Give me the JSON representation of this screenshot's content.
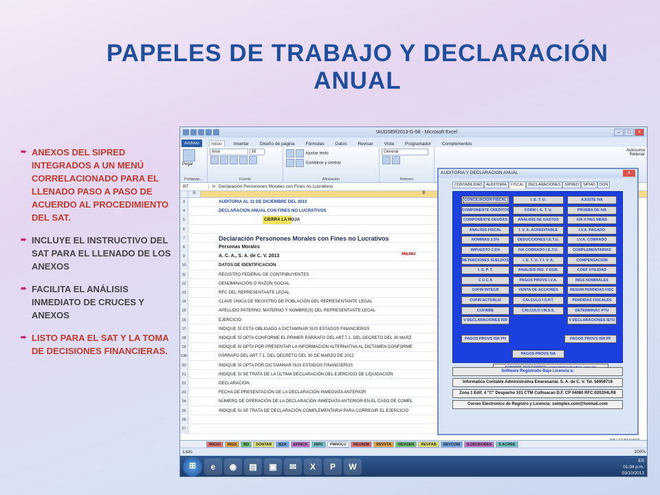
{
  "slide": {
    "title": "PAPELES DE TRABAJO Y DECLARACIÓN ANUAL",
    "bullets": [
      {
        "text": "ANEXOS DEL SIPRED INTEGRADOS A UN MENÚ CORRELACIONADO PARA EL LLENADO PASO A PASO DE ACUERDO AL PROCEDIMIENTO DEL SAT."
      },
      {
        "text": "INCLUYE EL INSTRUCTIVO DEL SAT PARA EL LLENADO DE LOS ANEXOS"
      },
      {
        "text": "FACILITA EL ANÁLISIS INMEDIATO DE CRUCES Y ANEXOS"
      },
      {
        "text": "LISTO PARA EL SAT Y LA TOMA DE DECISIONES FINANCIERAS."
      }
    ]
  },
  "excel": {
    "window_title": "!AUDSER2013-G-58 - Microsoft Excel",
    "tabs": [
      "Archivo",
      "Inicio",
      "Insertar",
      "Diseño de página",
      "Fórmulas",
      "Datos",
      "Revisar",
      "Vista",
      "Programador",
      "Complementos"
    ],
    "ribbon": {
      "paste": "Pegar",
      "font_name": "Arial",
      "font_size": "16",
      "wrap": "Ajustar texto",
      "merge": "Combinar y centrar",
      "number_format": "General",
      "autosum": "Autosuma",
      "fill": "Rellenar",
      "groups": [
        "Portapap...",
        "Fuente",
        "Alineación",
        "Número"
      ]
    },
    "name_box": "B7",
    "fx": "fx",
    "formula": "Declaración Personones Morales con Fines no Lucrativos",
    "columns": [
      "A",
      "B"
    ],
    "rows": [
      {
        "n": "3",
        "text": "AUDITORIA AL 31 DE DICIEMBRE DEL 2013"
      },
      {
        "n": "4",
        "text": "DECLARACION ANUAL CON FINES NO LUCRATIVOS"
      },
      {
        "n": "5",
        "text": "CIERRA LA HOJA"
      },
      {
        "n": "6",
        "text": ""
      },
      {
        "n": "7",
        "text": "Declaración Personones Morales con Fines no Lucrativos"
      },
      {
        "n": "8",
        "text": "Personas Morales"
      },
      {
        "n": "9",
        "text": "A. C. A., S. A. de C. V. 2013"
      },
      {
        "n": "10",
        "text": "DATOS DE IDENTIFICACION"
      },
      {
        "n": "11",
        "text": "REGISTRO FEDERAL DE CONTRIBUYENTES"
      },
      {
        "n": "12",
        "text": "DENOMINACIÓN O RAZON SOCIAL"
      },
      {
        "n": "13",
        "text": "RFC DEL REPRESENTANTE LEGAL"
      },
      {
        "n": "14",
        "text": "CLAVE ÚNICA DE REGISTRO DE POBLACIÓN DEL REPRESENTANTE LEGAL"
      },
      {
        "n": "15",
        "text": "APELLIDO PATERNO, MATERNO Y NOMBRE(S) DEL REPRESENTANTE LEGAL"
      },
      {
        "n": "16",
        "text": "EJERCICIO"
      },
      {
        "n": "17",
        "text": "INDIQUE SÍ ESTÁ OBLIGADO A DICTAMINAR SUS ESTADOS FINANCIEROS"
      },
      {
        "n": "18",
        "text": "INDIQUE SÍ OPTA CONFORME EL PRIMER PÁRRAFO DEL ART.7.1. DEL DECRETO DEL 30 MARZ"
      },
      {
        "n": "19",
        "text": "INDIQUE SI OPTA POR PRESENTAR LA INFORMACIÓN ALTERNATIVA AL DICTAMEN CONFORME"
      },
      {
        "n": "19b",
        "text": "PÁRRAFO DEL ART 7.1. DEL DECRETO DEL 30 DE MARZO DE 2012"
      },
      {
        "n": "20",
        "text": "INDIQUE SI OPTA POR DICTAMINAR SUS ESTADOS FINANCIEROS"
      },
      {
        "n": "21",
        "text": "INDIQUE SI SE TRATA DE LA ÚLTIMA DECLARACIÓN DEL EJERCICIO DE LIQUIDACIÓN"
      },
      {
        "n": "22",
        "text": "DECLARACIÓN"
      },
      {
        "n": "23",
        "text": "FECHA DE PRESENTACIÓN DE LA DECLARACIÓN INMEDIATA ANTERIOR"
      },
      {
        "n": "24",
        "text": "NÚMERO DE OPERACIÓN DE LA DECLARACIÓN INMEDIATA ANTERIOR EN EL CASO DE COMPL"
      },
      {
        "n": "25",
        "text": "INDIQUE SI SE TRATA DE DECLARACIÓN COMPLEMENTARIA PARA CORREGIR EL EJERCICIO"
      },
      {
        "n": "26",
        "text": ""
      },
      {
        "n": "27",
        "text": ""
      }
    ],
    "menu_label": "MENU",
    "sheet_tabs": [
      "INICIO",
      "INGS",
      "BD",
      "DONTAR",
      "BZA",
      "EFINCS",
      "INPC",
      "PMNOLU",
      "REVADM",
      "REVVTA",
      "REVGEN",
      "REVFAB",
      "REVCOM",
      "S.DEUDORES",
      "S.ACREE"
    ],
    "status_text": "Listo",
    "zoom": "100%",
    "tray_lang": "ES",
    "clock_time": "01:34 p.m.",
    "clock_date": "03/10/2013",
    "right_fragment": "PTU GENERADA"
  },
  "dialog": {
    "title": "AUDITORIA Y DECLARACION ANUAL",
    "close": "x",
    "tabs": [
      "CONTABILIDAD",
      "AUDITORIA",
      "FISCAL",
      "DECLARACIONES",
      "SIPRED",
      "SIPIAD",
      "DON"
    ],
    "col1": [
      "CONCILIACION FISCAL",
      "COMPONENTE CREDITOS",
      "COMPONENTE DEUDAS",
      "ANALISIS FISCAL",
      "NOMINAS 2.5%",
      "IMPUESTO 2.5%",
      "RETENCIONES SUELDOS",
      "I. S. P. T.",
      "C U C A",
      "CUFIN INTEGR",
      "CUFIN ACTUALIZ",
      "CUFINRE",
      "V DECLARACIONES ISR"
    ],
    "col2": [
      "I. E. T. U.",
      "FORM I. E. T. U.",
      "ANALISIS DE GASTOS",
      "I. V. A. ACREDITABLE",
      "DEDUCCIONES I.E.T.U.",
      "IVA COBRADO I.E.T.U.",
      "I. E. T. U.  Y  I. V. A.",
      "ANALISIS ING. Y EGR.",
      "PAGOS PROVS I.V.A.",
      "VENTA DE ACCIONES",
      "CALCULO I.S.P.T.",
      "CALCULO I.M.S.S."
    ],
    "col3": [
      "AJUSTE IVA",
      "PRUEBA DE IVA",
      "IVA X PAG MENS",
      "I.V.A.  PAGADO",
      "I.V.A. COBRADO",
      "COMPLEMENTARIAS",
      "COMPENSACION",
      "COEF UTILIDAD",
      "INGS NOMINALES",
      "RESUM PERDIDAS FISC",
      "PERDIDAS FISCALES",
      "DETERMINAC  PTU",
      "V DECLARACIONES IETU"
    ],
    "pagos_isr_ph": "PAGOS PROVS ISR  PH",
    "pagos_isr_pf": "PAGOS PROVS ISR PF",
    "pagos_iva": "PAGOS PROVS IVA",
    "soporte": "SOPORTE POR CORREO: progsimplex@yahoo.com.mx",
    "license_header": "Software Registrado Bajo Licencia a:",
    "license_lines": [
      "Informatica Contable Administrativa Emeresarial. S. A. de C. V. Tel. 56958719",
      "Zona 1 Edif. 4 \"C\" Despacho 101 CTM Culhuacan D.F. CP 04080 RFC:020204LR8",
      "Correo Electronico de Registro y Licencia: ssimplex.com@hotmail.com"
    ]
  },
  "colors": {
    "title": "#1f4e9c",
    "bullet_red": "#c0392b",
    "panel_blue": "#1c3fe0"
  }
}
